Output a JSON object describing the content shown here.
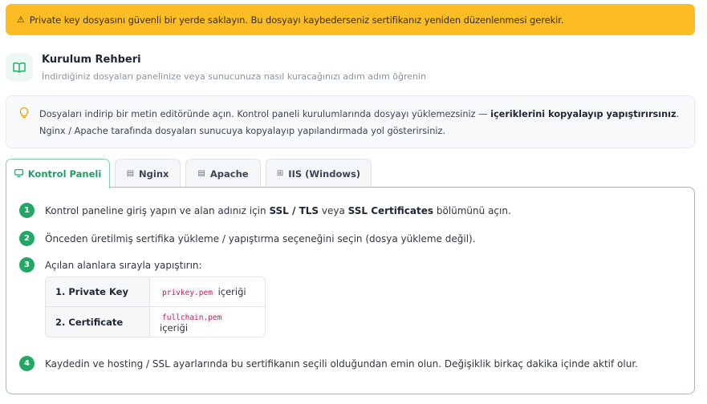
{
  "alert": {
    "icon": "warning-icon",
    "text": "Private key dosyasını güvenli bir yerde saklayın. Bu dosyayı kaybederseniz sertifikanız yeniden düzenlenmesi gerekir."
  },
  "guide": {
    "icon": "book-icon",
    "title": "Kurulum Rehberi",
    "subtitle": "İndirdiğiniz dosyaları panelinize veya sunucunuza nasıl kuracağınızı adım adım öğrenin"
  },
  "tip": {
    "icon": "lightbulb-icon",
    "text_before": "Dosyaları indirip bir metin editöründe açın. Kontrol paneli kurulumlarında dosyayı yüklemezsiniz — ",
    "bold": "içeriklerini kopyalayıp yapıştırırsınız",
    "text_after": ". Nginx / Apache tarafında dosyaları sunucuya kopyalayıp yapılandırmada yol gösterirsiniz."
  },
  "tabs": [
    {
      "label": "Kontrol Paneli",
      "icon": "monitor-icon",
      "active": true
    },
    {
      "label": "Nginx",
      "icon": "server-icon",
      "active": false
    },
    {
      "label": "Apache",
      "icon": "server-icon",
      "active": false
    },
    {
      "label": "IIS (Windows)",
      "icon": "windows-icon",
      "active": false
    }
  ],
  "steps": [
    {
      "num": "1",
      "t1": "Kontrol paneline giriş yapın ve alan adınız için ",
      "b1": "SSL / TLS",
      "t2": " veya ",
      "b2": "SSL Certificates",
      "t3": " bölümünü açın."
    },
    {
      "num": "2",
      "text": "Önceden üretilmiş sertifika yükleme / yapıştırma seçeneğini seçin (dosya yükleme değil)."
    },
    {
      "num": "3",
      "text": "Açılan alanlara sırayla yapıştırın:"
    },
    {
      "num": "4",
      "text": "Kaydedin ve hosting / SSL ayarlarında bu sertifikanın seçili olduğundan emin olun. Değişiklik birkaç dakika içinde aktif olur."
    }
  ],
  "paste_table": [
    {
      "key": "1. Private Key",
      "file": "privkey.pem",
      "suffix": " içeriği"
    },
    {
      "key": "2. Certificate",
      "file": "fullchain.pem",
      "suffix": " içeriği"
    }
  ],
  "colors": {
    "accent": "#22a865",
    "warning": "#fbbd23"
  }
}
